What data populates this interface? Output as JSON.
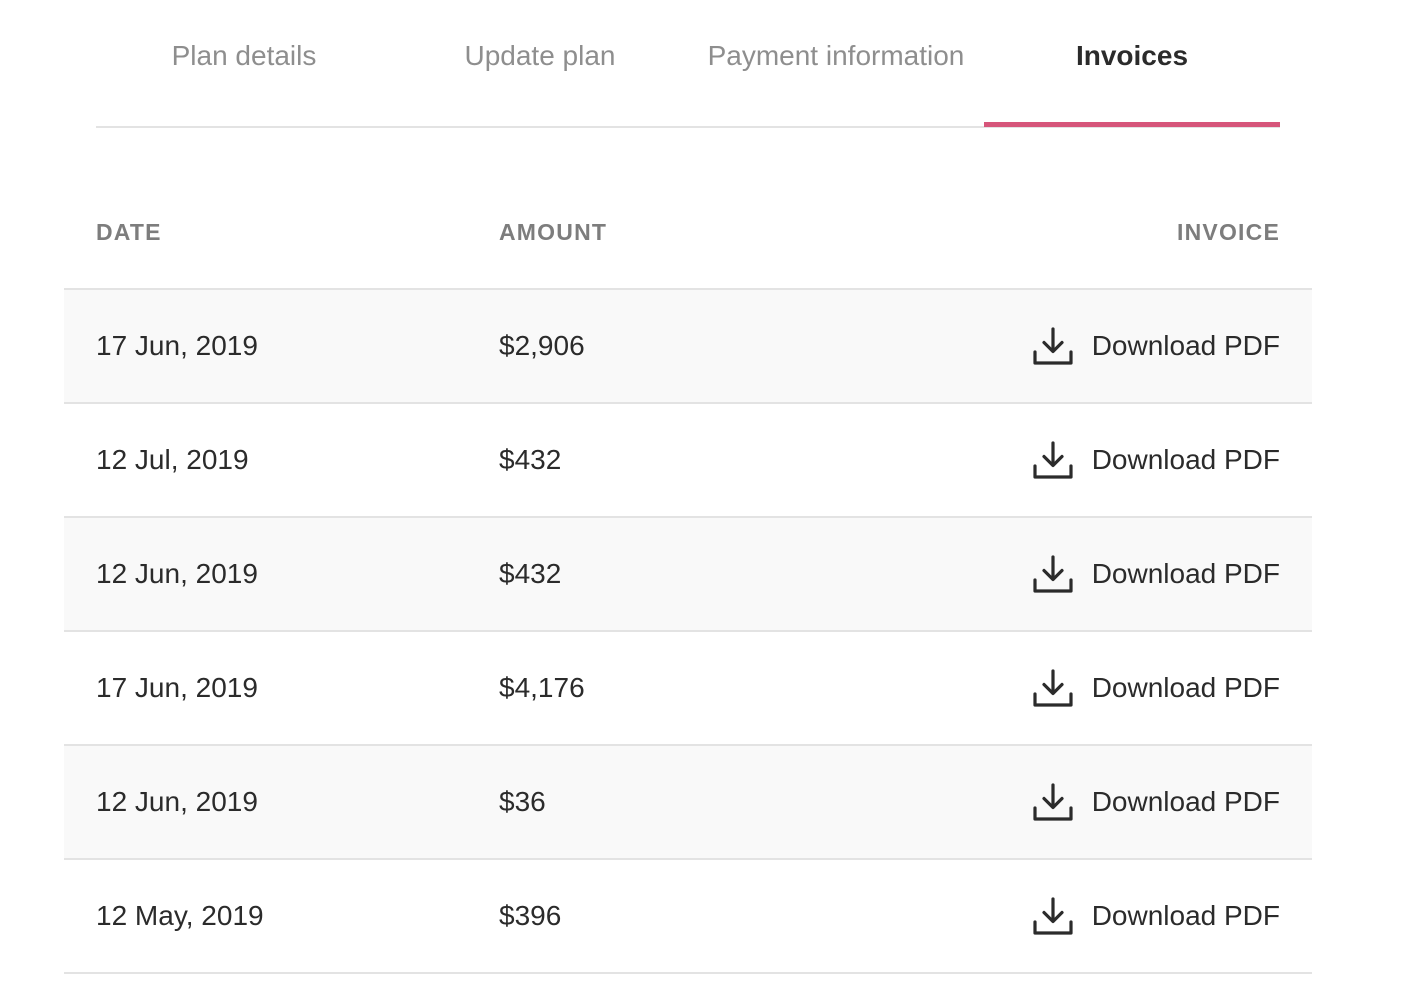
{
  "colors": {
    "accent": "#d6557a"
  },
  "tabs": [
    {
      "label": "Plan details",
      "active": false
    },
    {
      "label": "Update plan",
      "active": false
    },
    {
      "label": "Payment information",
      "active": false
    },
    {
      "label": "Invoices",
      "active": true
    }
  ],
  "table": {
    "headers": {
      "date": "DATE",
      "amount": "AMOUNT",
      "invoice": "INVOICE"
    },
    "rows": [
      {
        "date": "17 Jun, 2019",
        "amount": "$2,906",
        "action": "Download PDF",
        "icon": "download-icon"
      },
      {
        "date": "12 Jul, 2019",
        "amount": "$432",
        "action": "Download PDF",
        "icon": "download-icon"
      },
      {
        "date": "12 Jun, 2019",
        "amount": "$432",
        "action": "Download PDF",
        "icon": "download-icon"
      },
      {
        "date": "17 Jun, 2019",
        "amount": "$4,176",
        "action": "Download PDF",
        "icon": "download-icon"
      },
      {
        "date": "12 Jun, 2019",
        "amount": "$36",
        "action": "Download PDF",
        "icon": "download-icon"
      },
      {
        "date": "12 May, 2019",
        "amount": "$396",
        "action": "Download PDF",
        "icon": "download-icon"
      }
    ]
  }
}
